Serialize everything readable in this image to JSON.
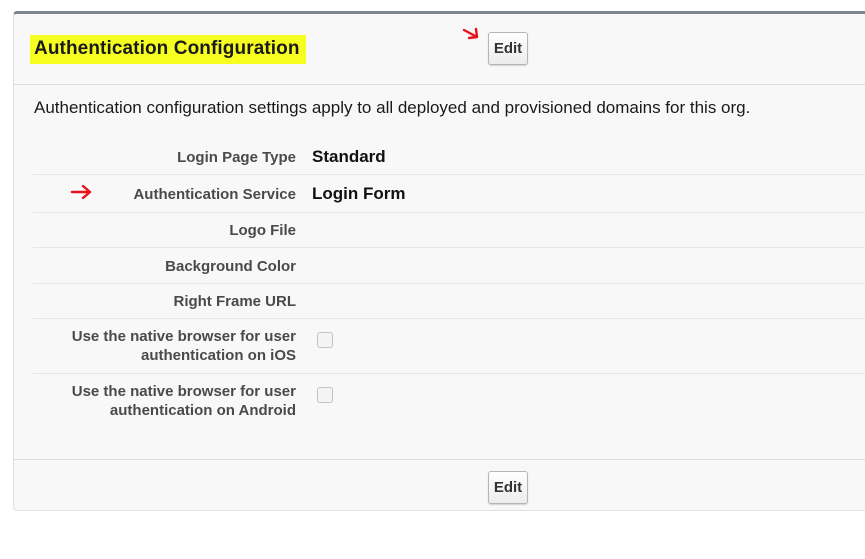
{
  "section": {
    "title": "Authentication Configuration",
    "edit_label": "Edit",
    "description": "Authentication configuration settings apply to all deployed and provisioned domains for this org.",
    "highlight_color": "#f6ff20",
    "annotation_color": "#e8121a"
  },
  "fields": [
    {
      "label": "Login Page Type",
      "value": "Standard"
    },
    {
      "label": "Authentication Service",
      "value": "Login Form"
    },
    {
      "label": "Logo File",
      "value": ""
    },
    {
      "label": "Background Color",
      "value": ""
    },
    {
      "label": "Right Frame URL",
      "value": ""
    },
    {
      "label_line1": "Use the native browser for user",
      "label_line2": "authentication on iOS",
      "checked": false
    },
    {
      "label_line1": "Use the native browser for user",
      "label_line2": "authentication on Android",
      "checked": false
    }
  ]
}
